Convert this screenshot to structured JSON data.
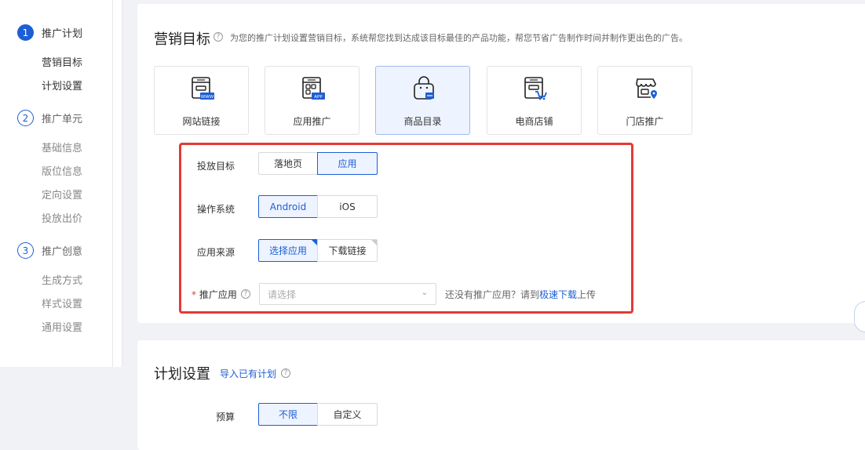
{
  "sidebar": {
    "steps": [
      {
        "num": "1",
        "label": "推广计划",
        "subs": [
          "营销目标",
          "计划设置"
        ]
      },
      {
        "num": "2",
        "label": "推广单元",
        "subs": [
          "基础信息",
          "版位信息",
          "定向设置",
          "投放出价"
        ]
      },
      {
        "num": "3",
        "label": "推广创意",
        "subs": [
          "生成方式",
          "样式设置",
          "通用设置"
        ]
      }
    ]
  },
  "marketing": {
    "title": "营销目标",
    "help": "?",
    "desc": "为您的推广计划设置营销目标，系统帮您找到达成该目标最佳的产品功能，帮您节省广告制作时间并制作更出色的广告。",
    "goals": [
      {
        "label": "网站链接",
        "icon": "website-icon",
        "badge": "WWW"
      },
      {
        "label": "应用推广",
        "icon": "app-icon",
        "badge": "APP"
      },
      {
        "label": "商品目录",
        "icon": "product-catalog-icon",
        "selected": true
      },
      {
        "label": "电商店铺",
        "icon": "ecommerce-store-icon"
      },
      {
        "label": "门店推广",
        "icon": "store-location-icon"
      }
    ]
  },
  "form": {
    "target_label": "投放目标",
    "target_options": [
      "落地页",
      "应用"
    ],
    "target_selected": "应用",
    "os_label": "操作系统",
    "os_options": [
      "Android",
      "iOS"
    ],
    "os_selected": "Android",
    "source_label": "应用来源",
    "source_options": [
      "选择应用",
      "下载链接"
    ],
    "source_selected": "选择应用",
    "app_label": "推广应用",
    "app_required": "*",
    "app_placeholder": "请选择",
    "hint_pre": "还没有推广应用？请到",
    "hint_link": "极速下载",
    "hint_post": "上传"
  },
  "plan": {
    "title": "计划设置",
    "import_link": "导入已有计划",
    "budget_label": "预算",
    "budget_options": [
      "不限",
      "自定义"
    ],
    "budget_selected": "不限"
  },
  "colors": {
    "accent": "#1d5ed4",
    "highlight_box": "#e53935"
  }
}
